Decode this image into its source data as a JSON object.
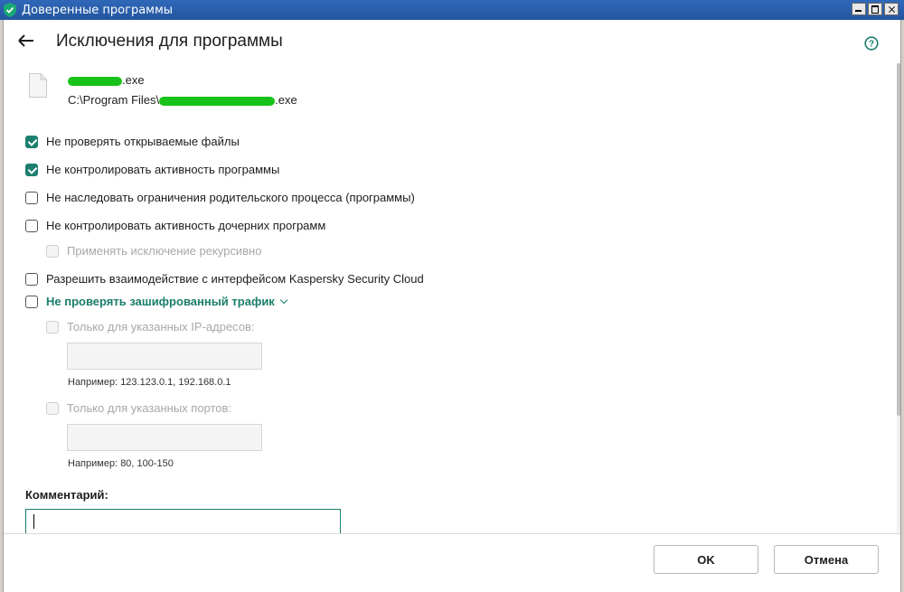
{
  "window": {
    "title": "Доверенные программы"
  },
  "page": {
    "title": "Исключения для программы"
  },
  "file": {
    "name_suffix": ".exe",
    "path_prefix": "C:\\Program Files\\",
    "path_suffix": ".exe"
  },
  "options": {
    "no_scan_files": {
      "label": "Не проверять открываемые файлы",
      "checked": true
    },
    "no_control_activity": {
      "label": "Не контролировать активность программы",
      "checked": true
    },
    "no_inherit": {
      "label": "Не наследовать ограничения родительского процесса (программы)",
      "checked": false
    },
    "no_control_children": {
      "label": "Не контролировать активность дочерних программ",
      "checked": false
    },
    "recursive": {
      "label": "Применять исключение рекурсивно",
      "checked": false,
      "disabled": true
    },
    "allow_interface": {
      "label": "Разрешить взаимодействие с интерфейсом Kaspersky Security Cloud",
      "checked": false
    },
    "no_scan_encrypted": {
      "label": "Не проверять зашифрованный трафик",
      "checked": false
    },
    "only_ips": {
      "label": "Только для указанных IP-адресов:",
      "checked": false,
      "disabled": true,
      "hint": "Например: 123.123.0.1, 192.168.0.1"
    },
    "only_ports": {
      "label": "Только для указанных портов:",
      "checked": false,
      "disabled": true,
      "hint": "Например: 80, 100-150"
    }
  },
  "comment": {
    "label": "Комментарий:",
    "value": ""
  },
  "buttons": {
    "ok": "OK",
    "cancel": "Отмена"
  },
  "colors": {
    "accent": "#1c7f6f",
    "titlebar": "#2f68b8"
  }
}
